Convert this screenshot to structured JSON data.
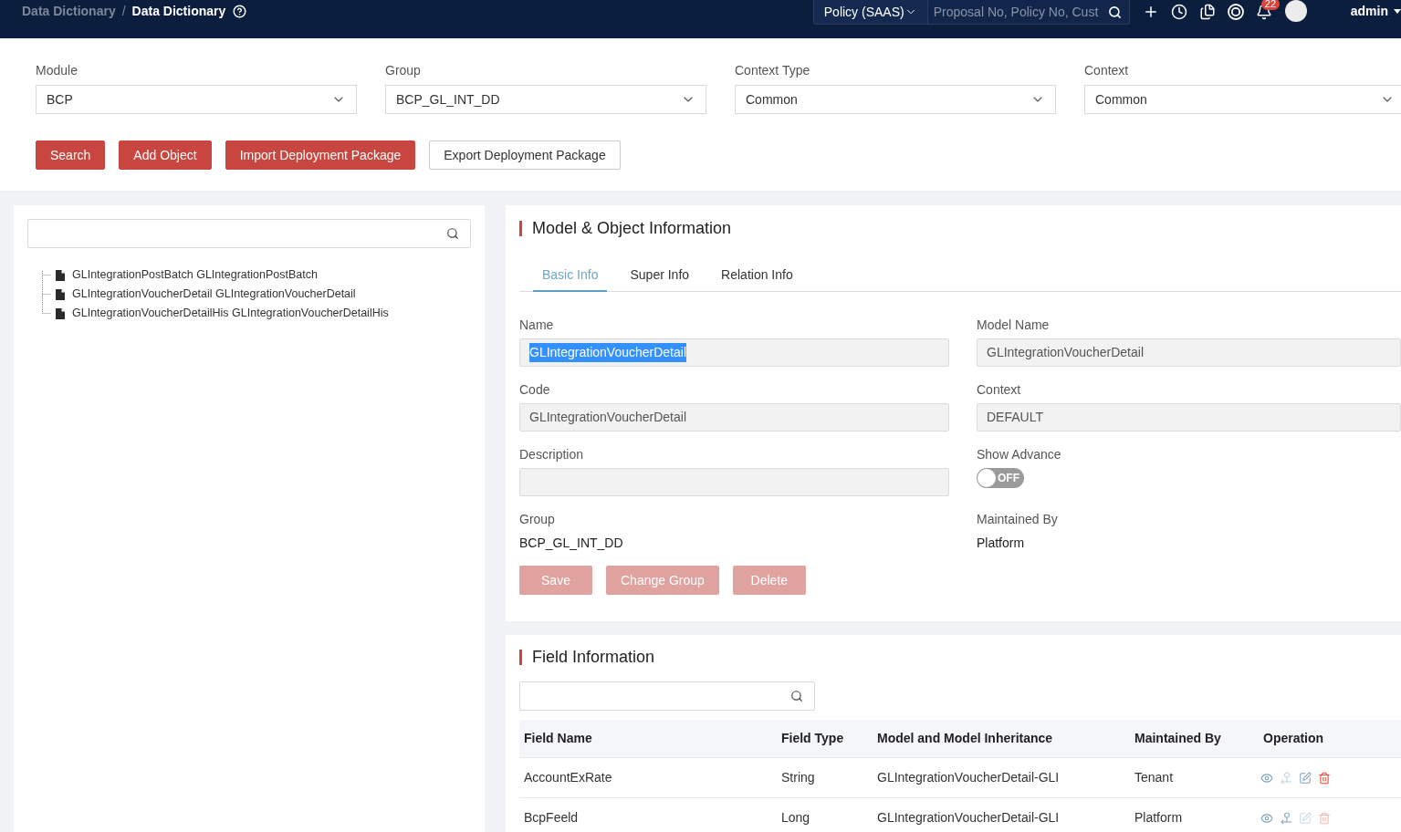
{
  "header": {
    "breadcrumb": [
      {
        "label": "Data Dictionary",
        "separator": "/",
        "current": false
      },
      {
        "label": "Data Dictionary",
        "current": true
      }
    ],
    "scope": {
      "label": "Policy (SAAS)"
    },
    "search": {
      "placeholder": "Proposal No, Policy No, Cust"
    },
    "notifications": {
      "count": "22"
    },
    "user": {
      "name": "admin"
    }
  },
  "filters": [
    {
      "label": "Module",
      "value": "BCP"
    },
    {
      "label": "Group",
      "value": "BCP_GL_INT_DD"
    },
    {
      "label": "Context Type",
      "value": "Common"
    },
    {
      "label": "Context",
      "value": "Common"
    }
  ],
  "actions": [
    {
      "label": "Search",
      "kind": "primary"
    },
    {
      "label": "Add Object",
      "kind": "primary"
    },
    {
      "label": "Import Deployment Package",
      "kind": "primary"
    },
    {
      "label": "Export Deployment Package",
      "kind": "default"
    }
  ],
  "tree": {
    "items": [
      {
        "label": "GLIntegrationPostBatch GLIntegrationPostBatch"
      },
      {
        "label": "GLIntegrationVoucherDetail GLIntegrationVoucherDetail"
      },
      {
        "label": "GLIntegrationVoucherDetailHis GLIntegrationVoucherDetailHis"
      }
    ]
  },
  "model_panel": {
    "title": "Model & Object Information",
    "tabs": [
      {
        "label": "Basic Info",
        "selected": true
      },
      {
        "label": "Super Info",
        "selected": false
      },
      {
        "label": "Relation Info",
        "selected": false
      }
    ],
    "fields": [
      {
        "kind": "input",
        "label": "Name",
        "value": "GLIntegrationVoucherDetail",
        "disabled": true,
        "highlighted": true
      },
      {
        "kind": "input",
        "label": "Model Name",
        "value": "GLIntegrationVoucherDetail",
        "disabled": true,
        "highlighted": false
      },
      {
        "kind": "input",
        "label": "Code",
        "value": "GLIntegrationVoucherDetail",
        "disabled": true,
        "highlighted": false
      },
      {
        "kind": "input",
        "label": "Context",
        "value": "DEFAULT",
        "disabled": true,
        "highlighted": false
      },
      {
        "kind": "input",
        "label": "Description",
        "disabled": true
      },
      {
        "kind": "toggle",
        "label": "Show Advance",
        "on": false,
        "state_label": "OFF"
      },
      {
        "kind": "text",
        "label": "Group",
        "value": "BCP_GL_INT_DD"
      },
      {
        "kind": "text",
        "label": "Maintained By",
        "value": "Platform"
      }
    ],
    "buttons": [
      {
        "label": "Save",
        "disabled": true
      },
      {
        "label": "Change Group",
        "disabled": true
      },
      {
        "label": "Delete",
        "disabled": true
      }
    ]
  },
  "field_panel": {
    "title": "Field Information",
    "table": {
      "columns": [
        "Field Name",
        "Field Type",
        "Model and Model Inheritance",
        "Maintained By",
        "Operation"
      ],
      "rows": [
        {
          "cells": [
            "AccountExRate",
            "String",
            "GLIntegrationVoucherDetail-GLI",
            "Tenant"
          ],
          "actions": [
            {
              "kind": "view",
              "disabled": false
            },
            {
              "kind": "relation",
              "disabled": true
            },
            {
              "kind": "edit",
              "disabled": false
            },
            {
              "kind": "delete",
              "disabled": false
            }
          ]
        },
        {
          "cells": [
            "BcpFeeld",
            "Long",
            "GLIntegrationVoucherDetail-GLI",
            "Platform"
          ],
          "actions": [
            {
              "kind": "view",
              "disabled": false
            },
            {
              "kind": "relation",
              "disabled": false
            },
            {
              "kind": "edit",
              "disabled": true
            },
            {
              "kind": "delete",
              "disabled": true
            }
          ]
        }
      ]
    }
  }
}
